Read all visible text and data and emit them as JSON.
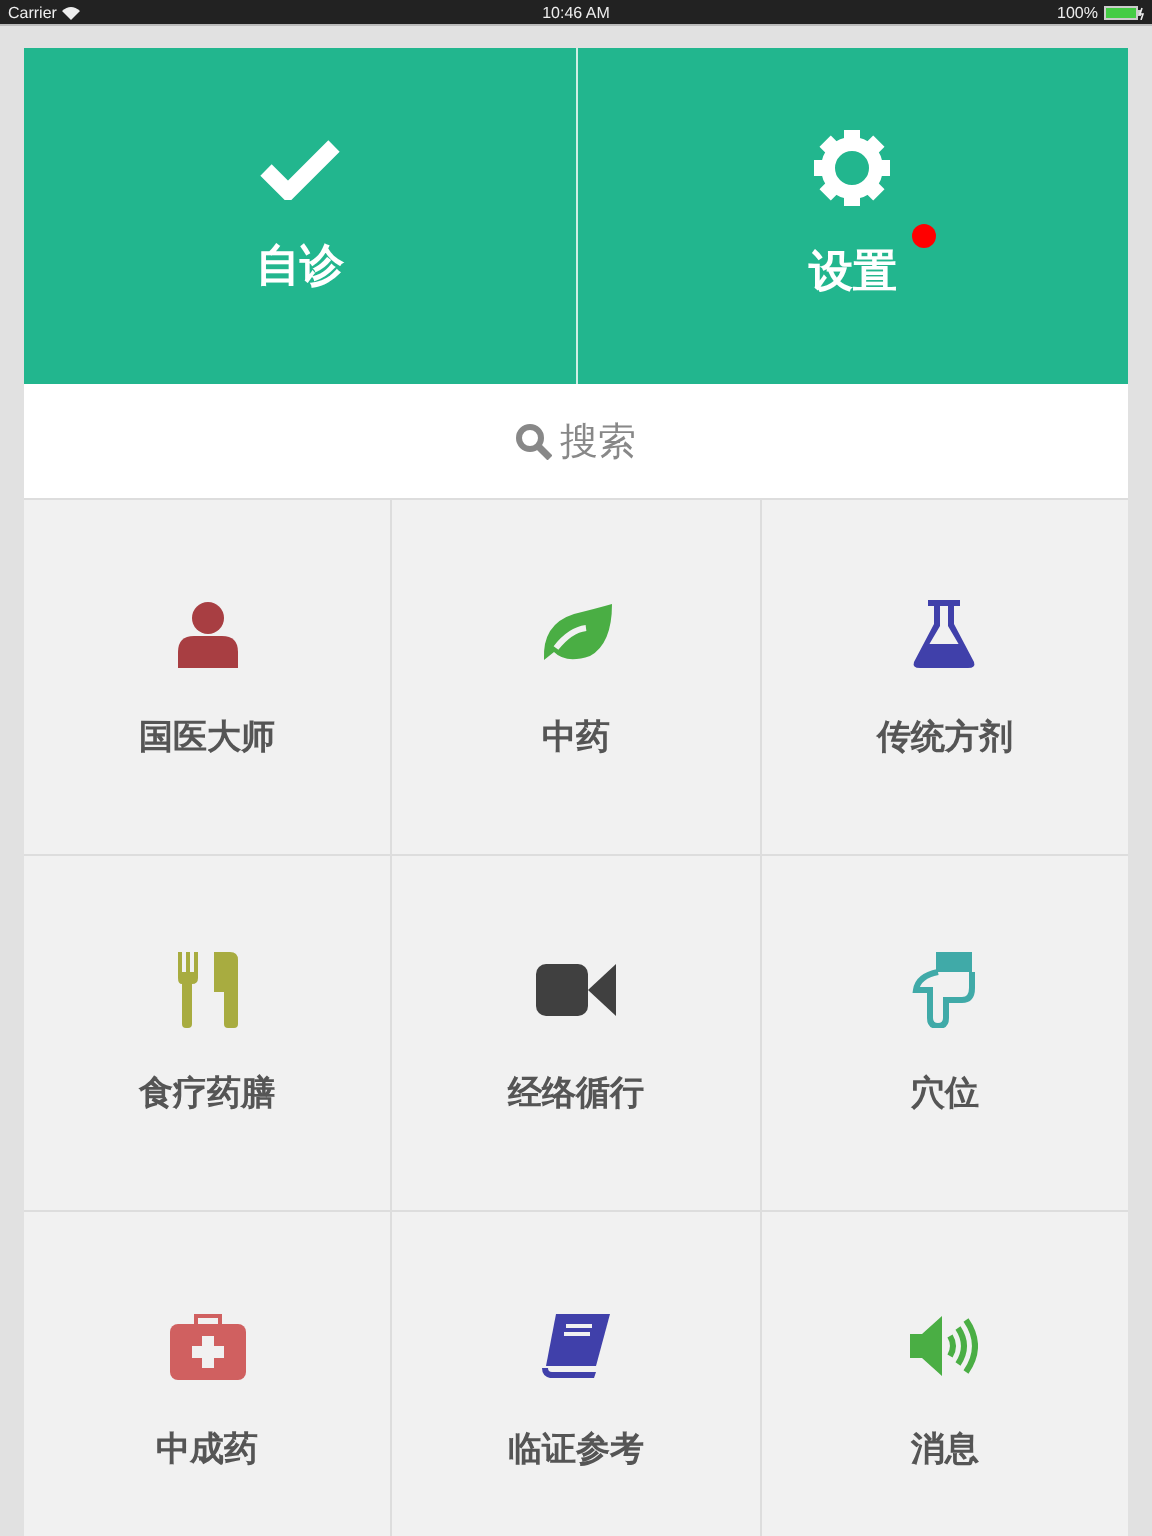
{
  "status_bar": {
    "carrier": "Carrier",
    "time": "10:46 AM",
    "battery": "100%"
  },
  "top_buttons": [
    {
      "label": "自诊",
      "kind": "check",
      "badge": false
    },
    {
      "label": "设置",
      "kind": "gear",
      "badge": true
    }
  ],
  "search": {
    "placeholder": "搜索"
  },
  "grid": [
    {
      "label": "国医大师",
      "kind": "person",
      "color": "#a83e42"
    },
    {
      "label": "中药",
      "kind": "leaf",
      "color": "#4aae44"
    },
    {
      "label": "传统方剂",
      "kind": "flask",
      "color": "#4040aa"
    },
    {
      "label": "食疗药膳",
      "kind": "cutlery",
      "color": "#a8ac40"
    },
    {
      "label": "经络循行",
      "kind": "video",
      "color": "#404040"
    },
    {
      "label": "穴位",
      "kind": "hand",
      "color": "#40aaa8"
    },
    {
      "label": "中成药",
      "kind": "medkit",
      "color": "#d06060"
    },
    {
      "label": "临证参考",
      "kind": "book",
      "color": "#4040aa"
    },
    {
      "label": "消息",
      "kind": "speaker",
      "color": "#4aae44"
    }
  ]
}
